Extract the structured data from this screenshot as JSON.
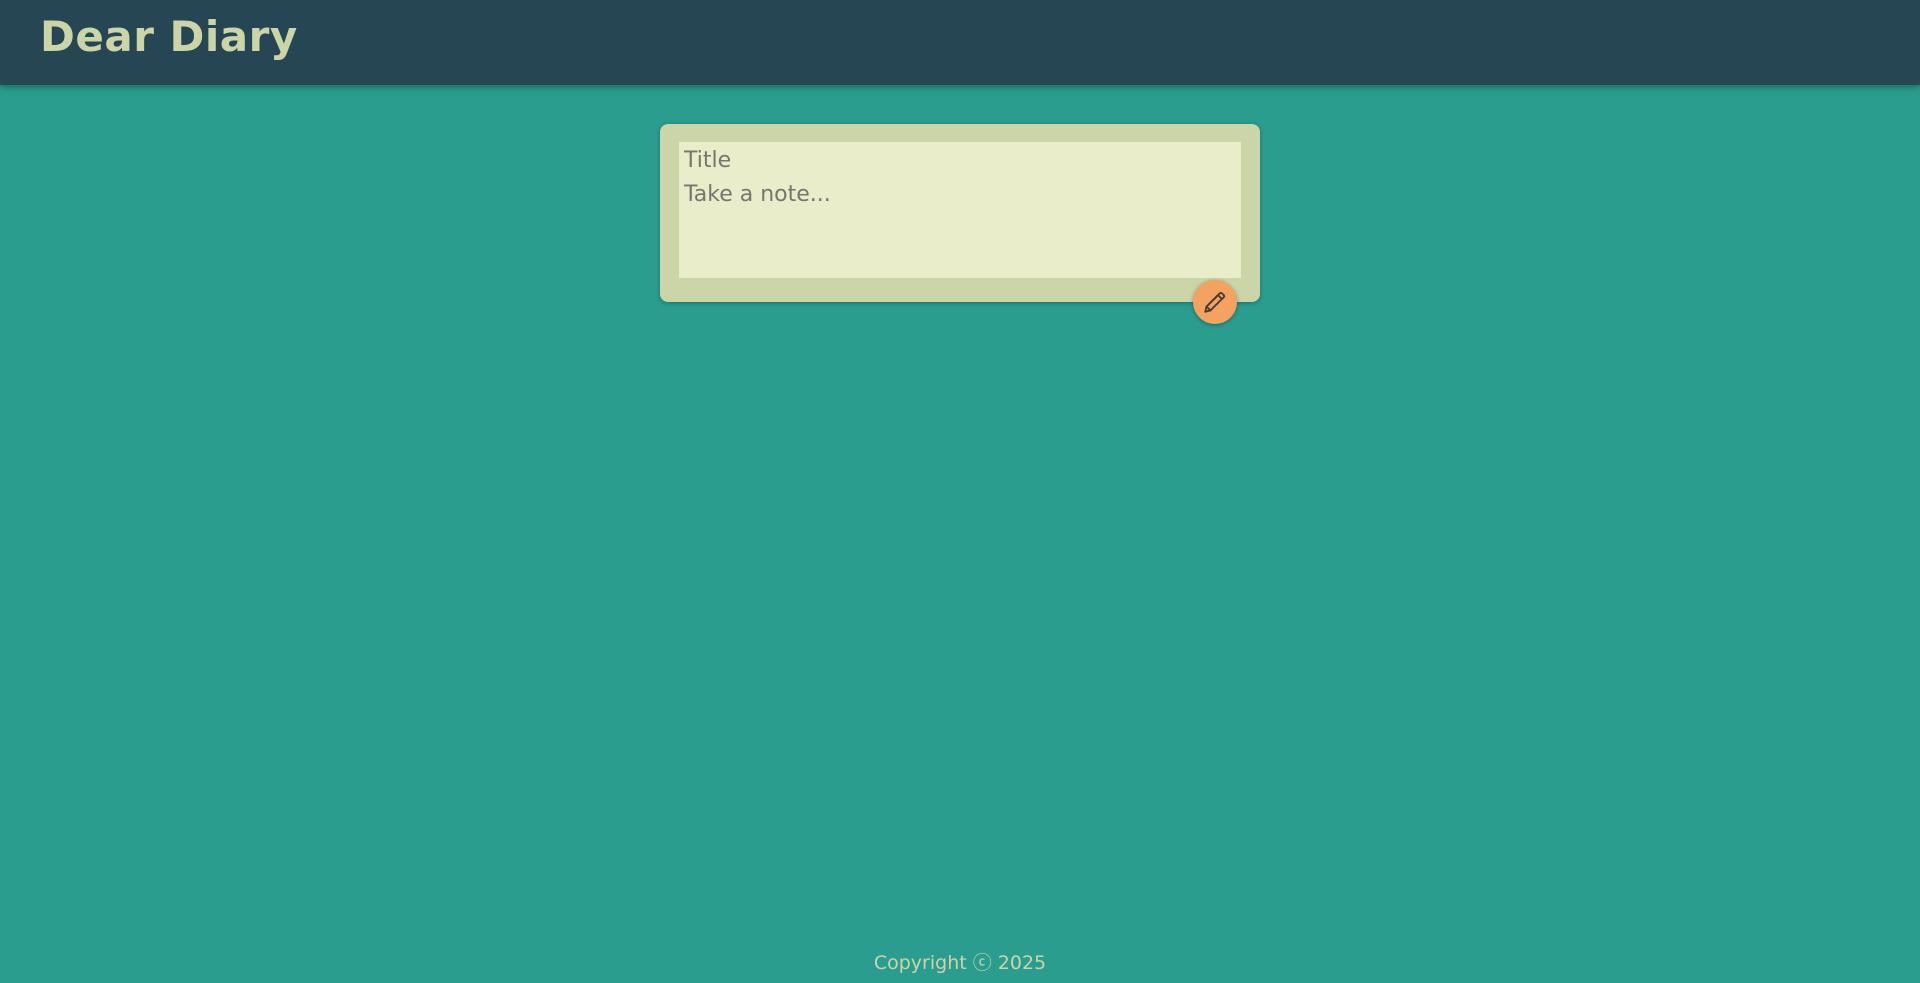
{
  "header": {
    "title": "Dear Diary"
  },
  "note_form": {
    "title_placeholder": "Title",
    "title_value": "",
    "content_placeholder": "Take a note...",
    "content_value": "",
    "add_button_icon": "pencil-icon"
  },
  "footer": {
    "copyright": "Copyright ⓒ 2025"
  },
  "colors": {
    "background": "#2a9d8f",
    "header": "#264653",
    "card": "#cbd5a8",
    "input_area": "#e9edc9",
    "accent_button": "#f4a261"
  }
}
